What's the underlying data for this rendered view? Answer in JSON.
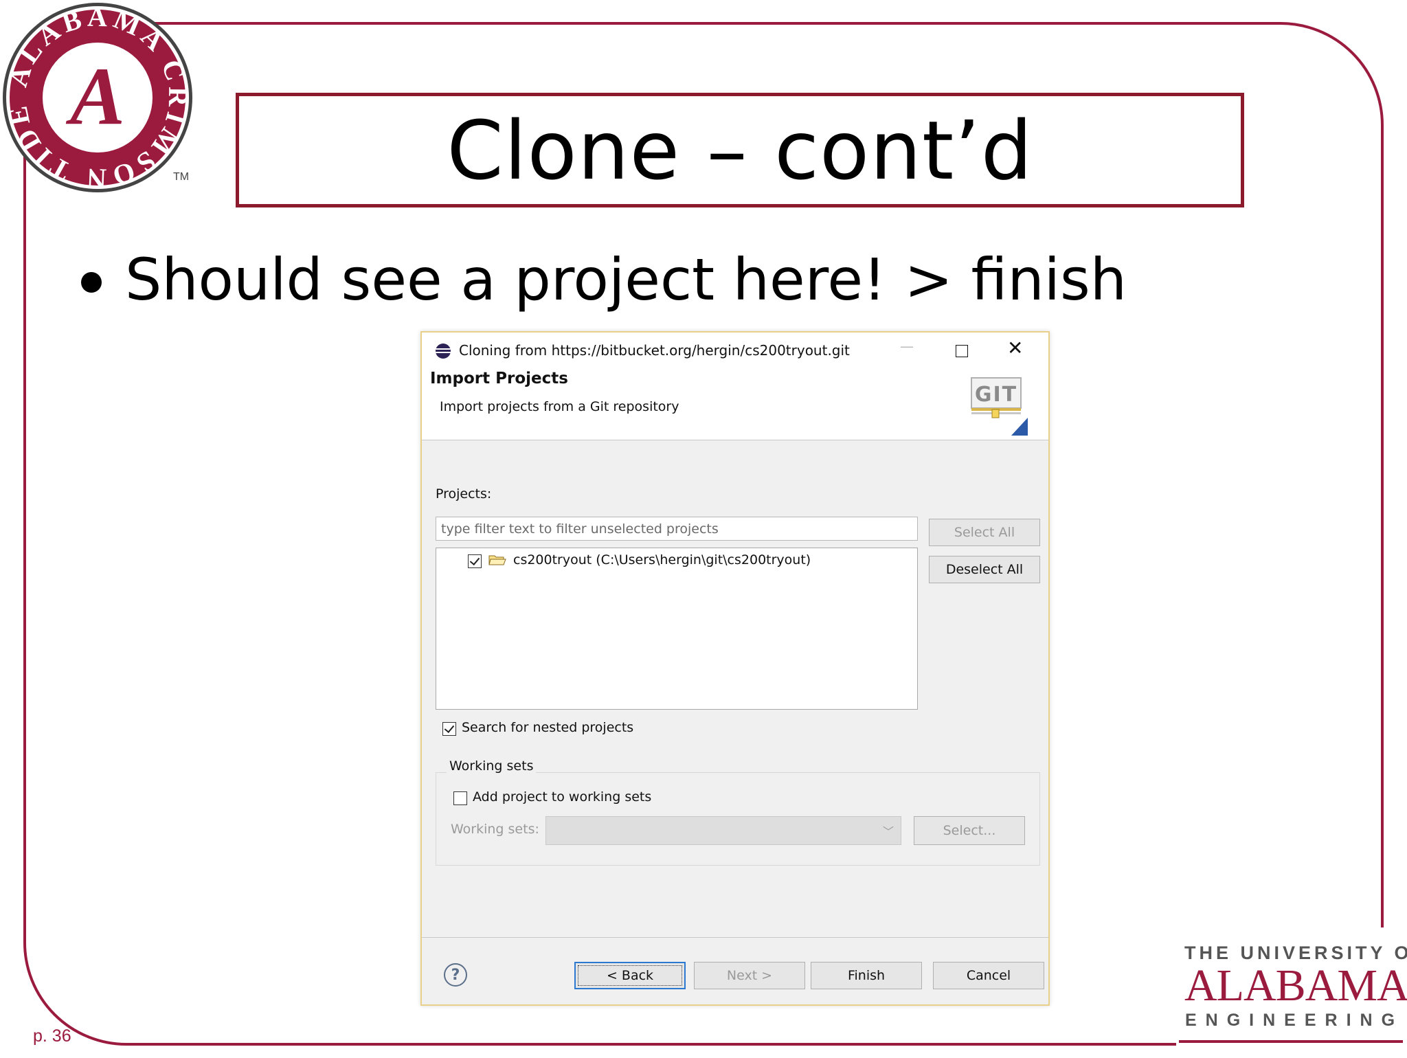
{
  "slide": {
    "title": "Clone – cont’d",
    "bullet": "Should see a project here! > finish",
    "page_number": "p. 36",
    "logo_seal_text": "ALABAMA CRIMSON TIDE",
    "logo_footer": {
      "line1": "THE UNIVERSITY OF",
      "line2": "ALABAMA",
      "line3": "ENGINEERING"
    }
  },
  "dialog": {
    "window_title": "Cloning from https://bitbucket.org/hergin/cs200tryout.git",
    "window_controls": {
      "minimize": "—",
      "close": "✕"
    },
    "header": {
      "title": "Import Projects",
      "subtitle": "Import projects from a Git repository",
      "icon": "git-icon"
    },
    "projects_label": "Projects:",
    "filter": {
      "value": "",
      "placeholder": "type filter text to filter unselected projects"
    },
    "buttons": {
      "select_all": "Select All",
      "deselect_all": "Deselect All",
      "back": "< Back",
      "next": "Next >",
      "finish": "Finish",
      "cancel": "Cancel",
      "ws_select": "Select..."
    },
    "projects": [
      {
        "label": "cs200tryout (C:\\Users\\hergin\\git\\cs200tryout)",
        "checked": true
      }
    ],
    "search_nested": {
      "label": "Search for nested projects",
      "checked": true
    },
    "working_sets": {
      "legend": "Working sets",
      "add_label": "Add project to working sets",
      "add_checked": false,
      "sets_label": "Working sets:",
      "sets_value": ""
    },
    "help_icon": "?"
  },
  "colors": {
    "crimson": "#9b1b3e",
    "accent_blue": "#2a78d0",
    "dialog_bg": "#f0f0f0"
  }
}
